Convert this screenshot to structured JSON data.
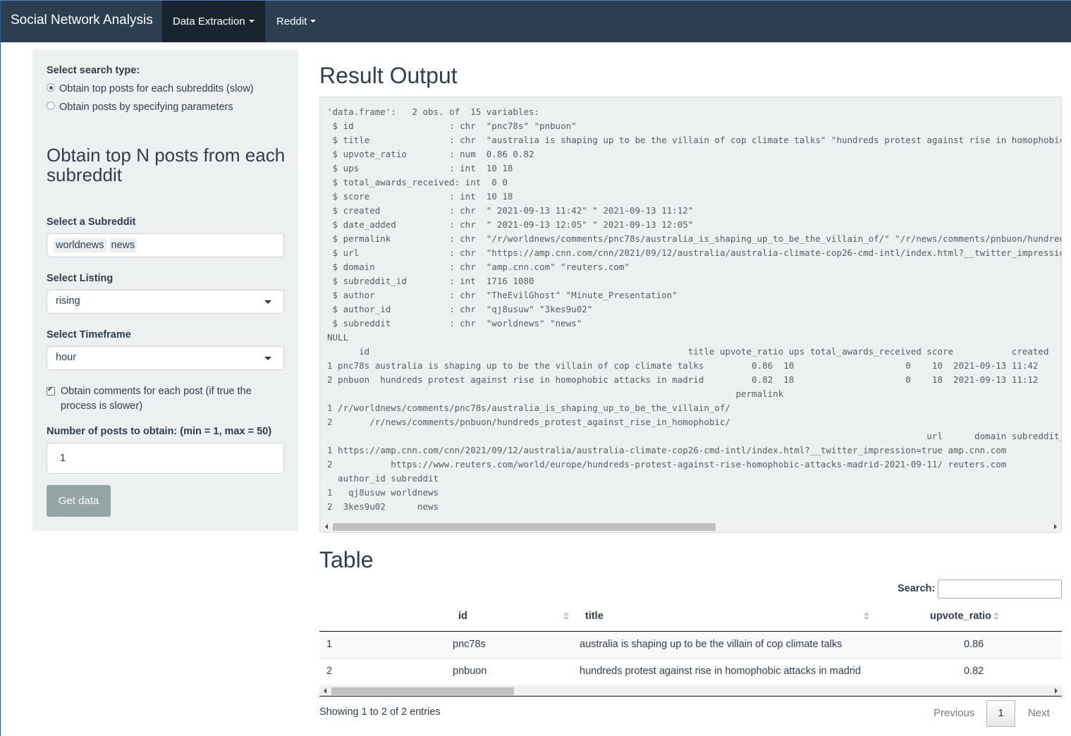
{
  "navbar": {
    "brand": "Social Network Analysis",
    "menu": [
      {
        "label": "Data Extraction"
      },
      {
        "label": "Reddit"
      }
    ]
  },
  "sidebar": {
    "search_type_label": "Select search type:",
    "search_options": [
      {
        "label": "Obtain top posts for each subreddits (slow)",
        "checked": true
      },
      {
        "label": "Obtain posts by specifying parameters",
        "checked": false
      }
    ],
    "panel_heading": "Obtain top N posts from each subreddit",
    "subreddit_label": "Select a Subreddit",
    "subreddit_tags": [
      "worldnews",
      "news"
    ],
    "listing_label": "Select Listing",
    "listing_value": "rising",
    "timeframe_label": "Select Timeframe",
    "timeframe_value": "hour",
    "comments_label": "Obtain comments for each post (if true the process is slower)",
    "comments_checked": true,
    "num_posts_label": "Number of posts to obtain: (min = 1, max = 50)",
    "num_posts_value": "1",
    "get_data_label": "Get data"
  },
  "main": {
    "result_heading": "Result Output",
    "console_lines": [
      "'data.frame':\t2 obs. of  15 variables:",
      " $ id                  : chr  \"pnc78s\" \"pnbuon\"",
      " $ title               : chr  \"australia is shaping up to be the villain of cop climate talks\" \"hundreds protest against rise in homophobic attacks in madrid\"",
      " $ upvote_ratio        : num  0.86 0.82",
      " $ ups                 : int  10 18",
      " $ total_awards_received: int  0 0",
      " $ score               : int  10 18",
      " $ created             : chr  \" 2021-09-13 11:42\" \" 2021-09-13 11:12\"",
      " $ date_added          : chr  \" 2021-09-13 12:05\" \" 2021-09-13 12:05\"",
      " $ permalink           : chr  \"/r/worldnews/comments/pnc78s/australia_is_shaping_up_to_be_the_villain_of/\" \"/r/news/comments/pnbuon/hundreds_protest_against_rise_in_homophobic/\"",
      " $ url                 : chr  \"https://amp.cnn.com/cnn/2021/09/12/australia/australia-climate-cop26-cmd-intl/index.html?__twitter_impression=true\"",
      " $ domain              : chr  \"amp.cnn.com\" \"reuters.com\"",
      " $ subreddit_id        : int  1716 1080",
      " $ author              : chr  \"TheEvilGhost\" \"Minute_Presentation\"",
      " $ author_id           : chr  \"qj8usuw\" \"3kes9u02\"",
      " $ subreddit           : chr  \"worldnews\" \"news\"",
      "NULL",
      "      id                                                            title upvote_ratio ups total_awards_received score           created",
      "1 pnc78s australia is shaping up to be the villain of cop climate talks         0.86  10                     0    10  2021-09-13 11:42",
      "2 pnbuon  hundreds protest against rise in homophobic attacks in madrid         0.82  18                     0    18  2021-09-13 11:12",
      "                                                                             permalink",
      "1 /r/worldnews/comments/pnc78s/australia_is_shaping_up_to_be_the_villain_of/",
      "2       /r/news/comments/pnbuon/hundreds_protest_against_rise_in_homophobic/",
      "                                                                                                                 url      domain subreddit_id",
      "1 https://amp.cnn.com/cnn/2021/09/12/australia/australia-climate-cop26-cmd-intl/index.html?__twitter_impression=true amp.cnn.com",
      "2           https://www.reuters.com/world/europe/hundreds-protest-against-rise-homophobic-attacks-madrid-2021-09-11/ reuters.com",
      "  author_id subreddit",
      "1   qj8usuw worldnews",
      "2  3kes9u02      news"
    ],
    "table_heading": "Table",
    "search_label": "Search:",
    "table": {
      "columns": [
        "id",
        "title",
        "upvote_ratio"
      ],
      "rows": [
        {
          "index": "1",
          "id": "pnc78s",
          "title": "australia is shaping up to be the villain of cop climate talks",
          "upvote_ratio": "0.86"
        },
        {
          "index": "2",
          "id": "pnbuon",
          "title": "hundreds protest against rise in homophobic attacks in madrid",
          "upvote_ratio": "0.82"
        }
      ]
    },
    "info_text": "Showing 1 to 2 of 2 entries",
    "pagination": {
      "previous": "Previous",
      "current_page": "1",
      "next": "Next"
    }
  },
  "colors": {
    "navbar": "#2c3e50",
    "navbar_active": "#1a242f",
    "sidebar_bg": "#ecf0f1",
    "button": "#95a5a6",
    "text": "#2c3e50"
  }
}
